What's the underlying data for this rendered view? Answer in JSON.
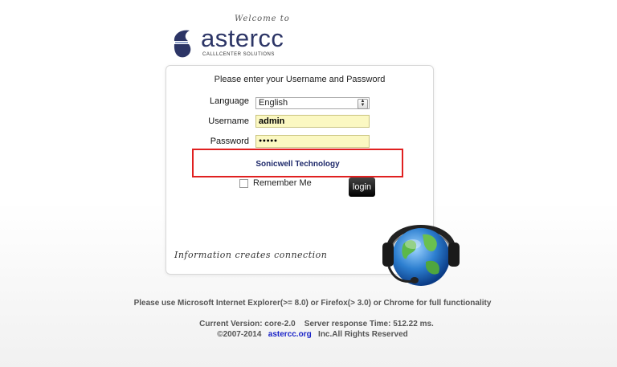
{
  "branding": {
    "welcome": "Welcome to",
    "name": "astercc",
    "tagline": "CALLLCENTER SOLUTIONS",
    "colors": {
      "primary": "#2c3566",
      "accent": "#e02020"
    }
  },
  "login_form": {
    "title": "Please enter your Username and Password",
    "language_label": "Language",
    "language_value": "English",
    "username_label": "Username",
    "username_value": "admin",
    "password_label": "Password",
    "password_value": "●●●●●",
    "company": "Sonicwell Technology",
    "remember_label": "Remember Me",
    "login_label": "login",
    "slogan": "Information creates connection"
  },
  "footer": {
    "browser_note": "Please use Microsoft Internet Explorer(>= 8.0) or Firefox(> 3.0) or Chrome for full functionality",
    "version": "Current Version: core-2.0",
    "response": "Server response Time: 512.22 ms.",
    "copyright": "©2007-2014",
    "site_link": "astercc.org",
    "rights": "Inc.All Rights Reserved"
  },
  "icons": [
    "astercc-logo-icon",
    "globe-headset-icon",
    "dropdown-arrow-icon"
  ]
}
